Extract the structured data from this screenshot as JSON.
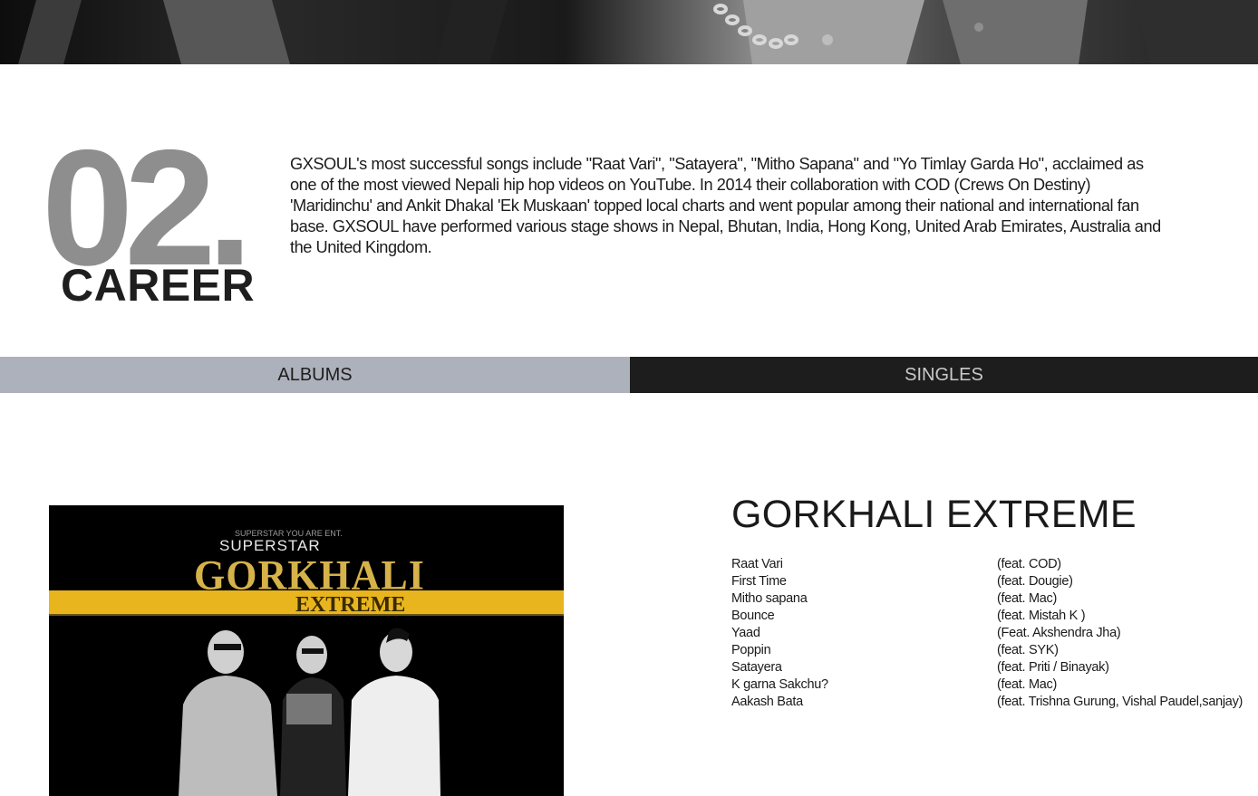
{
  "career": {
    "number": "02.",
    "title": "CAREER",
    "description": "GXSOUL's most successful songs include \"Raat Vari\", \"Satayera\", \"Mitho Sapana\" and \"Yo Timlay Garda Ho\", acclaimed as one of the most viewed Nepali hip hop videos on YouTube. In 2014 their collaboration with COD (Crews On Destiny) 'Maridinchu' and Ankit Dhakal 'Ek Muskaan' topped local charts and went popular among their national and international fan base. GXSOUL have performed various stage shows in Nepal, Bhutan, India, Hong Kong, United Arab Emirates, Australia and the United Kingdom."
  },
  "tabs": {
    "albums_label": "ALBUMS",
    "singles_label": "SINGLES",
    "active": "albums"
  },
  "album": {
    "title": "GORKHALI EXTREME",
    "cover_text": {
      "top_line": "SUPERSTAR YOU ARE ENT.",
      "superstar": "SUPERSTAR",
      "gorkhali": "GORKHALI",
      "extreme": "EXTREME"
    },
    "tracks": [
      {
        "name": "Raat Vari",
        "feat": "(feat. COD)"
      },
      {
        "name": "First Time",
        "feat": "(feat. Dougie)"
      },
      {
        "name": "Mitho sapana",
        "feat": "(feat. Mac)"
      },
      {
        "name": "Bounce",
        "feat": "(feat. Mistah K )"
      },
      {
        "name": "Yaad",
        "feat": "(Feat. Akshendra Jha)"
      },
      {
        "name": "Poppin",
        "feat": "(feat. SYK)"
      },
      {
        "name": "Satayera",
        "feat": "(feat. Priti / Binayak)"
      },
      {
        "name": "K garna Sakchu?",
        "feat": "(feat. Mac)"
      },
      {
        "name": "Aakash Bata",
        "feat": "(feat. Trishna Gurung, Vishal Paudel,sanjay)"
      }
    ]
  },
  "colors": {
    "number_gray": "#8e8e8e",
    "tab_albums_bg": "#adb1bb",
    "tab_singles_bg": "#1d1d1d",
    "cover_stripe": "#e8b51e"
  }
}
